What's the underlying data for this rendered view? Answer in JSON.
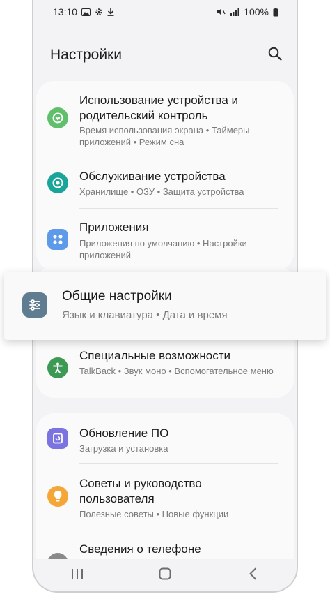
{
  "status_bar": {
    "time": "13:10",
    "battery": "100%"
  },
  "header": {
    "title": "Настройки"
  },
  "items": [
    {
      "title": "Использование устройства и родительский контроль",
      "subtitle": "Время использования экрана • Таймеры приложений • Режим сна",
      "icon": "digital-wellbeing-icon",
      "color": "#5fbf6a"
    },
    {
      "title": "Обслуживание устройства",
      "subtitle": "Хранилище • ОЗУ • Защита устройства",
      "icon": "device-care-icon",
      "color": "#1aa59a"
    },
    {
      "title": "Приложения",
      "subtitle": "Приложения по умолчанию • Настройки приложений",
      "icon": "apps-icon",
      "color": "#5d9bea"
    },
    {
      "title": "Общие настройки",
      "subtitle": "Язык и клавиатура • Дата и время",
      "icon": "general-settings-icon",
      "color": "#5f7c90"
    },
    {
      "title": "Специальные возможности",
      "subtitle": "TalkBack • Звук моно • Вспомогательное меню",
      "icon": "accessibility-icon",
      "color": "#3d9a55"
    },
    {
      "title": "Обновление ПО",
      "subtitle": "Загрузка и установка",
      "icon": "software-update-icon",
      "color": "#7b73e0"
    },
    {
      "title": "Советы и руководство пользователя",
      "subtitle": "Полезные советы • Новые функции",
      "icon": "tips-icon",
      "color": "#f4a637"
    },
    {
      "title": "Сведения о телефоне",
      "icon": "about-phone-icon",
      "color": "#8a8a8a"
    }
  ],
  "navbar": {
    "recents": "recents-icon",
    "home": "home-icon",
    "back": "back-icon"
  }
}
